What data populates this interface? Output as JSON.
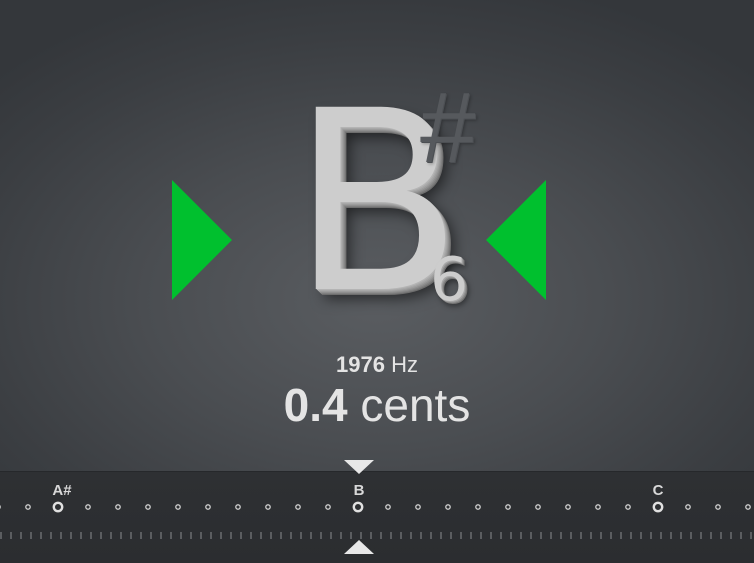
{
  "note": {
    "letter": "B",
    "accidental": "#",
    "octave": "6"
  },
  "readout": {
    "frequency_value": "1976",
    "frequency_unit": "Hz",
    "cents_value": "0.4",
    "cents_unit": "cents"
  },
  "scale": {
    "note_labels": [
      "A#",
      "B",
      "C"
    ]
  },
  "colors": {
    "in_tune_indicator": "#00c02e",
    "background": "#4a4d51",
    "note_text": "#cdcdcd",
    "accidental_dim": "#56595d",
    "strip_background": "#2e3033",
    "pointer": "#e8e8e8"
  },
  "icons": {
    "left_indicator": "triangle-right",
    "right_indicator": "triangle-left",
    "top_pointer": "triangle-down",
    "bottom_pointer": "triangle-up"
  }
}
